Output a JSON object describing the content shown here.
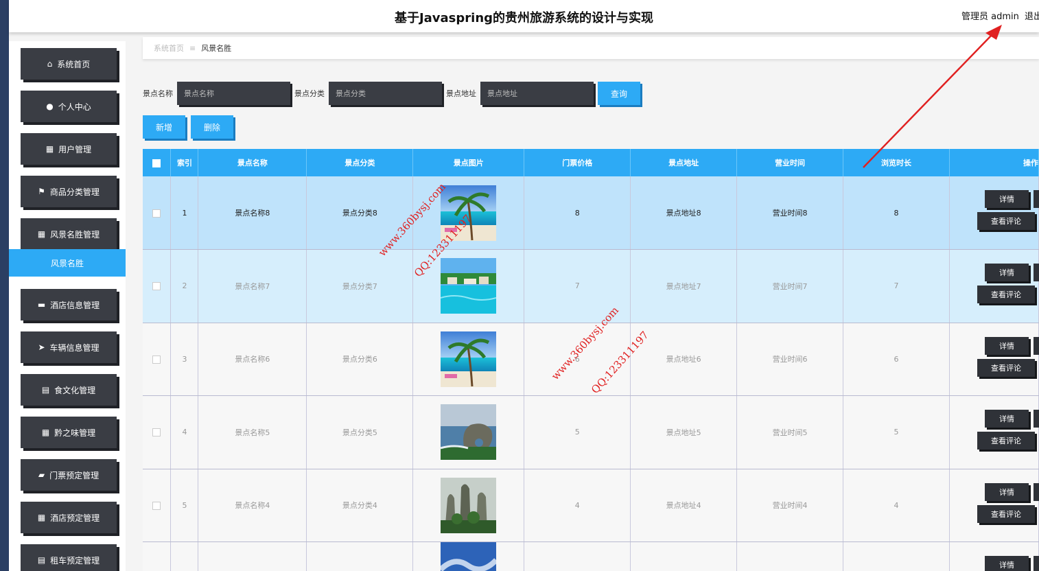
{
  "header": {
    "title": "基于Javaspring的贵州旅游系统的设计与实现",
    "user": "管理员 admin",
    "logout": "退出"
  },
  "sidebar": {
    "items": [
      {
        "label": "系统首页",
        "icon": "home-icon",
        "glyph": "⌂"
      },
      {
        "label": "个人中心",
        "icon": "user-icon",
        "glyph": "●"
      },
      {
        "label": "用户管理",
        "icon": "grid-icon",
        "glyph": "▦"
      },
      {
        "label": "商品分类管理",
        "icon": "flag-icon",
        "glyph": "⚑"
      },
      {
        "label": "风景名胜管理",
        "icon": "apps-icon",
        "glyph": "▦"
      },
      {
        "label": "酒店信息管理",
        "icon": "briefcase-icon",
        "glyph": "▬"
      },
      {
        "label": "车辆信息管理",
        "icon": "send-icon",
        "glyph": "➤"
      },
      {
        "label": "食文化管理",
        "icon": "clipboard-icon",
        "glyph": "▤"
      },
      {
        "label": "黔之味管理",
        "icon": "grid-icon",
        "glyph": "▦"
      },
      {
        "label": "门票预定管理",
        "icon": "wallet-icon",
        "glyph": "▰"
      },
      {
        "label": "酒店预定管理",
        "icon": "grid-icon",
        "glyph": "▦"
      },
      {
        "label": "租车预定管理",
        "icon": "clipboard-check-icon",
        "glyph": "▤"
      }
    ],
    "active_sub": "风景名胜"
  },
  "breadcrumb": {
    "home": "系统首页",
    "sep": "≡",
    "current": "风景名胜"
  },
  "search": {
    "name_label": "景点名称",
    "name_placeholder": "景点名称",
    "category_label": "景点分类",
    "category_placeholder": "景点分类",
    "address_label": "景点地址",
    "address_placeholder": "景点地址",
    "query_button": "查询"
  },
  "actions": {
    "add": "新增",
    "delete": "删除"
  },
  "table": {
    "headers": [
      "索引",
      "景点名称",
      "景点分类",
      "景点图片",
      "门票价格",
      "景点地址",
      "营业时间",
      "浏览时长",
      "操作"
    ],
    "detail_label": "详情",
    "review_label": "查看评论",
    "rows": [
      {
        "index": "1",
        "name": "景点名称8",
        "category": "景点分类8",
        "image": "beach-palm",
        "price": "8",
        "address": "景点地址8",
        "hours": "营业时间8",
        "duration": "8"
      },
      {
        "index": "2",
        "name": "景点名称7",
        "category": "景点分类7",
        "image": "resort-pool",
        "price": "7",
        "address": "景点地址7",
        "hours": "营业时间7",
        "duration": "7"
      },
      {
        "index": "3",
        "name": "景点名称6",
        "category": "景点分类6",
        "image": "beach-palm",
        "price": "6",
        "address": "景点地址6",
        "hours": "营业时间6",
        "duration": "6"
      },
      {
        "index": "4",
        "name": "景点名称5",
        "category": "景点分类5",
        "image": "sea-rock",
        "price": "5",
        "address": "景点地址5",
        "hours": "营业时间5",
        "duration": "5"
      },
      {
        "index": "5",
        "name": "景点名称4",
        "category": "景点分类4",
        "image": "karst-peaks",
        "price": "4",
        "address": "景点地址4",
        "hours": "营业时间4",
        "duration": "4"
      },
      {
        "index": "",
        "name": "",
        "category": "",
        "image": "blue-sky",
        "price": "",
        "address": "",
        "hours": "",
        "duration": ""
      }
    ]
  },
  "watermarks": [
    "www.360bysj.com",
    "QQ:123311197",
    "www.360bysj.com",
    "QQ:123311197"
  ],
  "colors": {
    "accent": "#2daaf5",
    "menu_dark": "#3a3d44",
    "selected_row": "#bfe3fb",
    "annotation": "#e02020"
  }
}
